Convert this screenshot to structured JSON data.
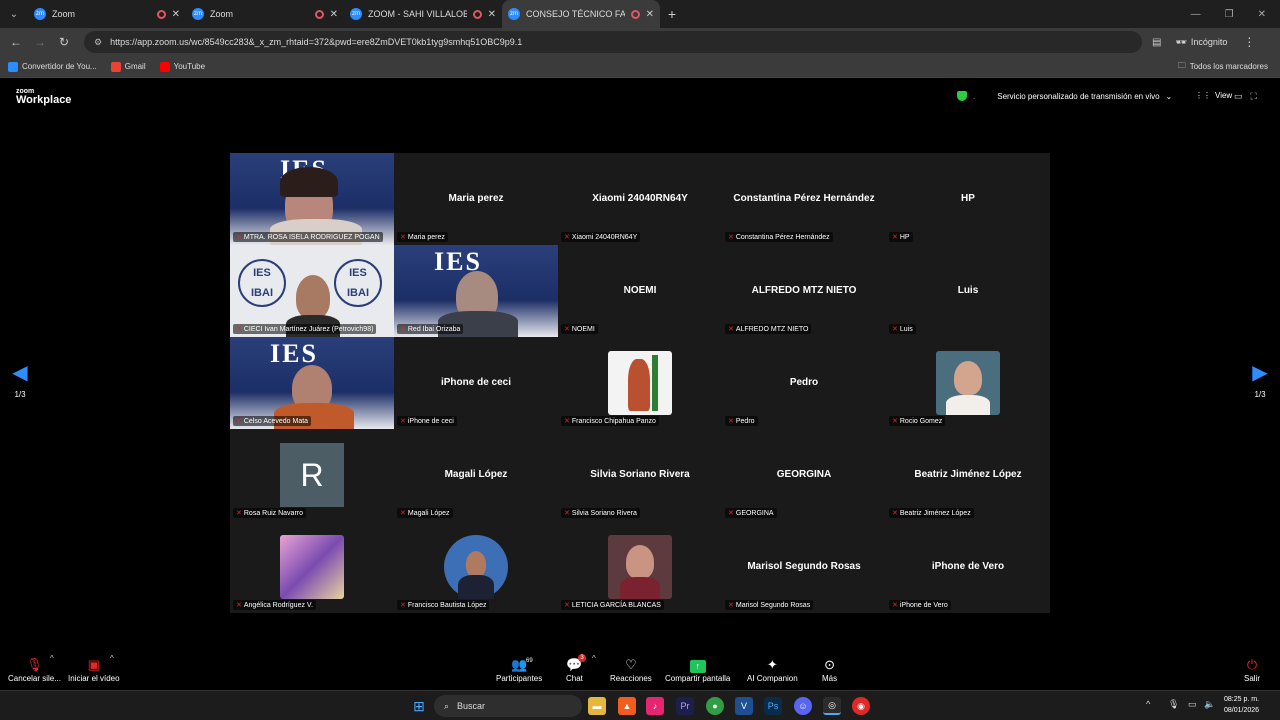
{
  "browser": {
    "tabs": [
      {
        "title": "Zoom",
        "active": false,
        "recording": true
      },
      {
        "title": "Zoom",
        "active": false,
        "recording": true
      },
      {
        "title": "ZOOM - SAHI VILLALOBOS",
        "active": false,
        "recording": true
      },
      {
        "title": "CONSEJO TÉCNICO FASE IN",
        "active": true,
        "recording": true
      }
    ],
    "url": "https://app.zoom.us/wc/8549cc283&_x_zm_rhtaid=372&pwd=ere8ZmDVET0kb1tyg9smhq51OBC9p9.1",
    "incognito_label": "Incógnito",
    "bookmarks": [
      {
        "label": "Convertidor de You...",
        "color": "#2d8cff"
      },
      {
        "label": "Gmail",
        "color": "#ea4335"
      },
      {
        "label": "YouTube",
        "color": "#ff0000"
      }
    ],
    "all_bookmarks_label": "Todos los marcadores"
  },
  "zoom": {
    "logo_top": "zoom",
    "logo_bottom": "Workplace",
    "stream_label": "Servicio personalizado de transmisión en vivo",
    "view_label": "View",
    "page_left": "1/3",
    "page_right": "1/3"
  },
  "participants": [
    {
      "name": "MTRA. ROSA ISELA RODRIGUEZ POGAN",
      "center": "",
      "kind": "video-ies-woman"
    },
    {
      "name": "Maria perez",
      "center": "Maria perez",
      "kind": "name"
    },
    {
      "name": "Xiaomi 24040RN64Y",
      "center": "Xiaomi 24040RN64Y",
      "kind": "name"
    },
    {
      "name": "Constantina Pérez Hernández",
      "center": "Constantina Pérez Hernández",
      "kind": "name"
    },
    {
      "name": "HP",
      "center": "HP",
      "kind": "name"
    },
    {
      "name": "CIECI Ivan Martínez Juárez (Petrovich98)",
      "center": "",
      "kind": "video-ibai"
    },
    {
      "name": "Red Ibai Orizaba",
      "center": "",
      "kind": "video-ies-man"
    },
    {
      "name": "NOEMI",
      "center": "NOEMI",
      "kind": "name"
    },
    {
      "name": "ALFREDO MTZ NIETO",
      "center": "ALFREDO MTZ NIETO",
      "kind": "name"
    },
    {
      "name": "Luis",
      "center": "Luis",
      "kind": "name"
    },
    {
      "name": "Celso Acevedo Mata",
      "center": "",
      "kind": "video-ies-man2"
    },
    {
      "name": "iPhone de ceci",
      "center": "iPhone de ceci",
      "kind": "name"
    },
    {
      "name": "Francisco Chipahua Panzo",
      "center": "",
      "kind": "thumb-warrior"
    },
    {
      "name": "Pedro",
      "center": "Pedro",
      "kind": "name"
    },
    {
      "name": "Rocio Gomez",
      "center": "",
      "kind": "thumb-woman"
    },
    {
      "name": "Rosa Ruiz Navarro",
      "center": "",
      "kind": "avatar-r",
      "initial": "R"
    },
    {
      "name": "Magali López",
      "center": "Magali López",
      "kind": "name"
    },
    {
      "name": "Silvia Soriano Rivera",
      "center": "Silvia Soriano Rivera",
      "kind": "name"
    },
    {
      "name": "GEORGINA",
      "center": "GEORGINA",
      "kind": "name"
    },
    {
      "name": "Beatriz Jiménez López",
      "center": "Beatriz Jiménez López",
      "kind": "name"
    },
    {
      "name": "Angélica Rodríguez V.",
      "center": "",
      "kind": "thumb-art"
    },
    {
      "name": "Francisco Bautista López",
      "center": "",
      "kind": "thumb-circle-man"
    },
    {
      "name": "LETICIA GARCÍA BLANCAS",
      "center": "",
      "kind": "thumb-woman2"
    },
    {
      "name": "Marisol Segundo Rosas",
      "center": "Marisol Segundo Rosas",
      "kind": "name"
    },
    {
      "name": "iPhone de Vero",
      "center": "iPhone de Vero",
      "kind": "name"
    }
  ],
  "toolbar": {
    "mute": "Cancelar sile...",
    "video": "Iniciar el vídeo",
    "participants": "Participantes",
    "participants_count": "69",
    "chat": "Chat",
    "chat_badge": "3",
    "reactions": "Reacciones",
    "share": "Compartir pantalla",
    "companion": "AI Companion",
    "more": "Más",
    "leave": "Salir"
  },
  "taskbar": {
    "search_placeholder": "Buscar",
    "time": "08:25 p. m.",
    "date": "08/01/2026"
  },
  "colors": {
    "accent": "#2d8cff",
    "muted_red": "#e02828",
    "share_green": "#21c35b"
  }
}
